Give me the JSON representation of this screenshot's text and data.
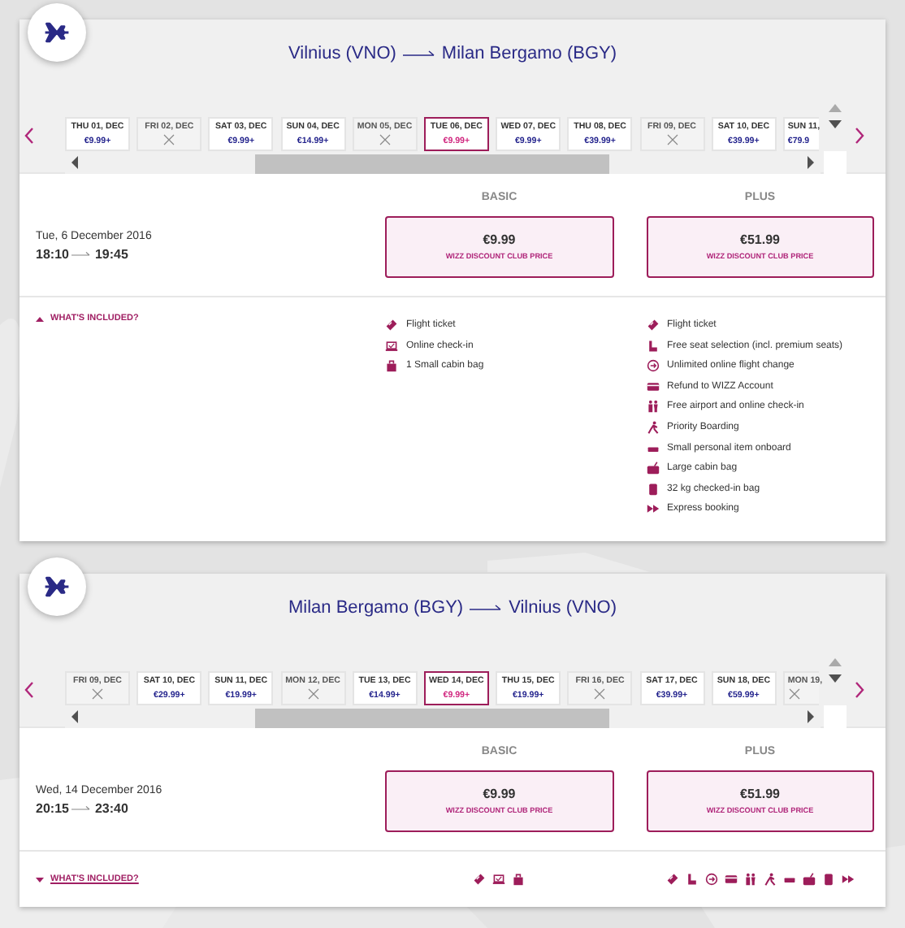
{
  "flights": [
    {
      "origin": "Vilnius (VNO)",
      "destination": "Milan Bergamo (BGY)",
      "days": [
        {
          "label": "THU 01, DEC",
          "price": "€9.99+",
          "available": true,
          "selected": false
        },
        {
          "label": "FRI 02, DEC",
          "available": false,
          "selected": false
        },
        {
          "label": "SAT 03, DEC",
          "price": "€9.99+",
          "available": true,
          "selected": false
        },
        {
          "label": "SUN 04, DEC",
          "price": "€14.99+",
          "available": true,
          "selected": false
        },
        {
          "label": "MON 05, DEC",
          "available": false,
          "selected": false
        },
        {
          "label": "TUE 06, DEC",
          "price": "€9.99+",
          "available": true,
          "selected": true
        },
        {
          "label": "WED 07, DEC",
          "price": "€9.99+",
          "available": true,
          "selected": false
        },
        {
          "label": "THU 08, DEC",
          "price": "€39.99+",
          "available": true,
          "selected": false
        },
        {
          "label": "FRI 09, DEC",
          "available": false,
          "selected": false
        },
        {
          "label": "SAT 10, DEC",
          "price": "€39.99+",
          "available": true,
          "selected": false
        },
        {
          "label": "SUN 11,",
          "price": "€79.9",
          "available": true,
          "selected": false
        }
      ],
      "date": "Tue, 6 December 2016",
      "departure": "18:10",
      "arrival": "19:45",
      "toggle": {
        "label": "WHAT'S INCLUDED?",
        "expanded": true
      },
      "fares": [
        {
          "name": "BASIC",
          "price": "€9.99",
          "note": "WIZZ DISCOUNT CLUB PRICE",
          "included": [
            {
              "kind": "ticket",
              "label": "Flight ticket"
            },
            {
              "kind": "checkin",
              "label": "Online check-in"
            },
            {
              "kind": "bag",
              "label": "1 Small cabin bag"
            }
          ]
        },
        {
          "name": "PLUS",
          "price": "€51.99",
          "note": "WIZZ DISCOUNT CLUB PRICE",
          "included": [
            {
              "kind": "ticket",
              "label": "Flight ticket"
            },
            {
              "kind": "seat",
              "label": "Free seat selection (incl. premium seats)"
            },
            {
              "kind": "change",
              "label": "Unlimited online flight change"
            },
            {
              "kind": "card",
              "label": "Refund to WIZZ Account"
            },
            {
              "kind": "people",
              "label": "Free airport and online check-in"
            },
            {
              "kind": "walker",
              "label": "Priority Boarding"
            },
            {
              "kind": "item",
              "label": "Small personal item onboard"
            },
            {
              "kind": "cabin",
              "label": "Large cabin bag"
            },
            {
              "kind": "suitcase",
              "label": "32 kg checked-in bag"
            },
            {
              "kind": "express",
              "label": "Express booking"
            }
          ]
        }
      ]
    },
    {
      "origin": "Milan Bergamo (BGY)",
      "destination": "Vilnius (VNO)",
      "days": [
        {
          "label": "FRI 09, DEC",
          "available": false,
          "selected": false
        },
        {
          "label": "SAT 10, DEC",
          "price": "€29.99+",
          "available": true,
          "selected": false
        },
        {
          "label": "SUN 11, DEC",
          "price": "€19.99+",
          "available": true,
          "selected": false
        },
        {
          "label": "MON 12, DEC",
          "available": false,
          "selected": false
        },
        {
          "label": "TUE 13, DEC",
          "price": "€14.99+",
          "available": true,
          "selected": false
        },
        {
          "label": "WED 14, DEC",
          "price": "€9.99+",
          "available": true,
          "selected": true
        },
        {
          "label": "THU 15, DEC",
          "price": "€19.99+",
          "available": true,
          "selected": false
        },
        {
          "label": "FRI 16, DEC",
          "available": false,
          "selected": false
        },
        {
          "label": "SAT 17, DEC",
          "price": "€39.99+",
          "available": true,
          "selected": false
        },
        {
          "label": "SUN 18, DEC",
          "price": "€59.99+",
          "available": true,
          "selected": false
        },
        {
          "label": "MON 19,",
          "available": false,
          "selected": false
        }
      ],
      "date": "Wed, 14 December 2016",
      "departure": "20:15",
      "arrival": "23:40",
      "toggle": {
        "label": "WHAT'S INCLUDED?",
        "expanded": false
      },
      "fares": [
        {
          "name": "BASIC",
          "price": "€9.99",
          "note": "WIZZ DISCOUNT CLUB PRICE",
          "included": [
            {
              "kind": "ticket"
            },
            {
              "kind": "checkin"
            },
            {
              "kind": "bag"
            }
          ]
        },
        {
          "name": "PLUS",
          "price": "€51.99",
          "note": "WIZZ DISCOUNT CLUB PRICE",
          "included": [
            {
              "kind": "ticket"
            },
            {
              "kind": "seat"
            },
            {
              "kind": "change"
            },
            {
              "kind": "card"
            },
            {
              "kind": "people"
            },
            {
              "kind": "walker"
            },
            {
              "kind": "item"
            },
            {
              "kind": "cabin"
            },
            {
              "kind": "suitcase"
            },
            {
              "kind": "express"
            }
          ]
        }
      ]
    }
  ]
}
